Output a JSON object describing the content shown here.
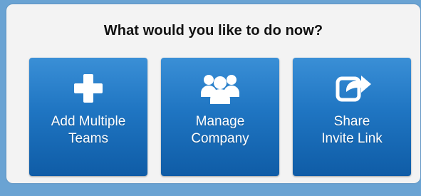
{
  "prompt": {
    "title": "What would you like to do now?"
  },
  "actions": [
    {
      "id": "add-multiple-teams",
      "icon": "plus-icon",
      "line1": "Add Multiple",
      "line2": "Teams"
    },
    {
      "id": "manage-company",
      "icon": "users-icon",
      "line1": "Manage",
      "line2": "Company"
    },
    {
      "id": "share-invite-link",
      "icon": "share-icon",
      "line1": "Share",
      "line2": "Invite Link"
    }
  ],
  "colors": {
    "page_background": "#6aa3d3",
    "panel_background": "#f3f3f3",
    "button_top": "#3a8fd6",
    "button_bottom": "#0f5ca6",
    "text_on_button": "#ffffff",
    "title_text": "#111111"
  }
}
